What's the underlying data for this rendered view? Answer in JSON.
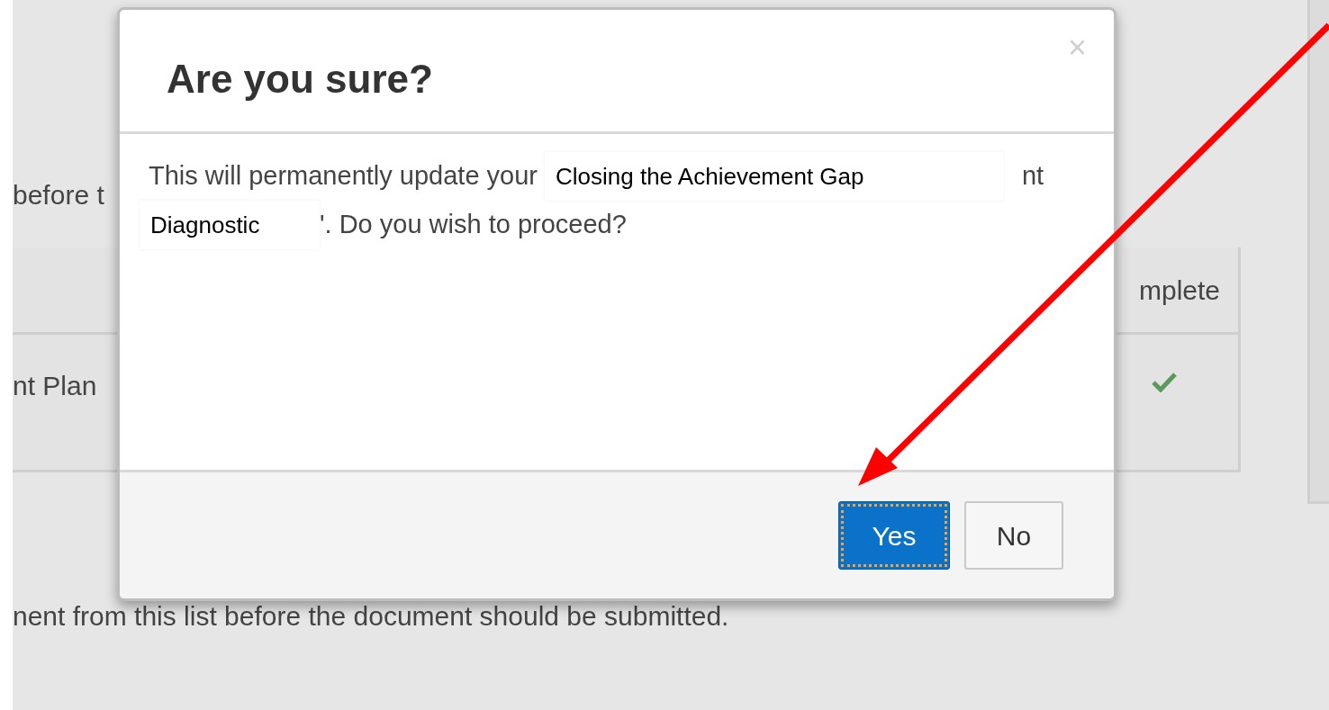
{
  "background": {
    "intro_text": "before t",
    "table": {
      "columns": [
        {
          "label": "mplete"
        }
      ],
      "rows": [
        {
          "label": "nt Plan",
          "complete": true
        }
      ]
    },
    "footer_text": "nent from this list before the document should be submitted."
  },
  "dialog": {
    "title": "Are you sure?",
    "close": "×",
    "lines": [
      [
        {
          "kind": "text",
          "text": "This will permanently update your"
        },
        {
          "kind": "overlay",
          "text": "Closing the Achievement Gap"
        },
        {
          "kind": "text",
          "text": "nt"
        }
      ],
      [
        {
          "kind": "overlay",
          "text": "Diagnostic"
        },
        {
          "kind": "text",
          "text": "'. Do you wish to proceed?"
        }
      ]
    ],
    "buttons": [
      {
        "label": "Yes",
        "primary": true,
        "focused": true
      },
      {
        "label": "No",
        "primary": false,
        "focused": false
      }
    ]
  }
}
